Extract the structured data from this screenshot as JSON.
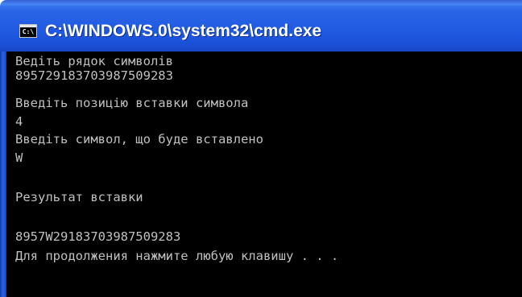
{
  "window": {
    "title": "C:\\WINDOWS.0\\system32\\cmd.exe",
    "icon_name": "cmd-console-icon",
    "icon_glyph": "C:\\"
  },
  "console": {
    "lines": [
      "Ведіть рядок символів",
      "89572918370398750928З",
      "Введіть позицію вставки символа",
      "4",
      "Введіть символ, що буде вставлено",
      "W",
      "",
      "Результат вставки",
      "",
      "8957W29183703987509283",
      "Для продолжения нажмите любую клавишу . . ."
    ],
    "text_color": "#c0c0c0",
    "background_color": "#000000"
  },
  "colors": {
    "titlebar_blue": "#1f59e0"
  }
}
